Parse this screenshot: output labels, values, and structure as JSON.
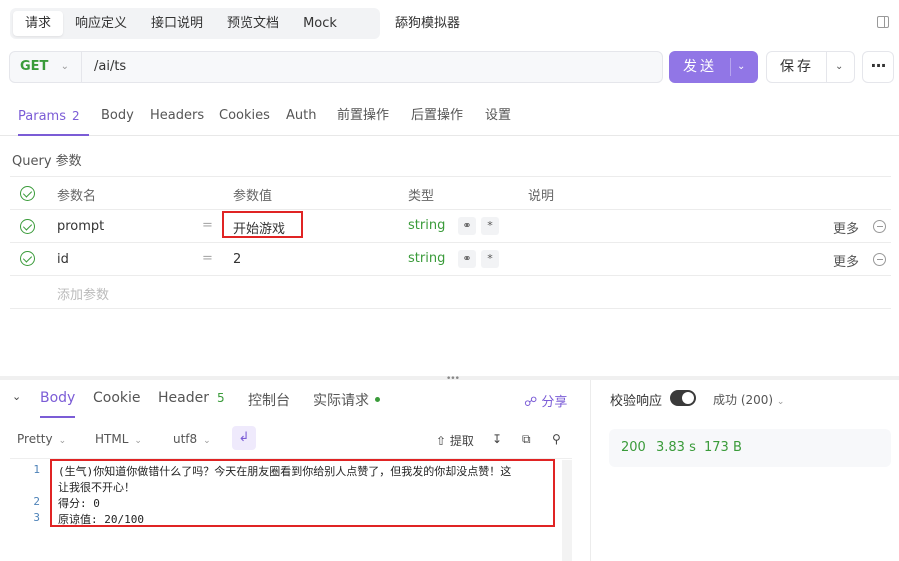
{
  "top_tabs": [
    "请求",
    "响应定义",
    "接口说明",
    "预览文档",
    "Mock"
  ],
  "top_tab_extra": "舔狗模拟器",
  "request": {
    "method": "GET",
    "url": "/ai/ts"
  },
  "buttons": {
    "send": "发送",
    "save": "保存",
    "more": "···"
  },
  "sub_tabs": [
    {
      "label": "Params",
      "count": "2"
    },
    {
      "label": "Body"
    },
    {
      "label": "Headers"
    },
    {
      "label": "Cookies"
    },
    {
      "label": "Auth"
    },
    {
      "label": "前置操作"
    },
    {
      "label": "后置操作"
    },
    {
      "label": "设置"
    }
  ],
  "query": {
    "title": "Query 参数",
    "headers": {
      "name": "参数名",
      "value": "参数值",
      "type": "类型",
      "desc": "说明"
    },
    "rows": [
      {
        "name": "prompt",
        "value": "开始游戏",
        "type": "string",
        "more": "更多"
      },
      {
        "name": "id",
        "value": "2",
        "type": "string",
        "more": "更多"
      }
    ],
    "add_placeholder": "添加参数"
  },
  "response_tabs": [
    {
      "label": "Body"
    },
    {
      "label": "Cookie"
    },
    {
      "label": "Header",
      "count": "5"
    },
    {
      "label": "控制台"
    },
    {
      "label": "实际请求"
    }
  ],
  "share_label": "分享",
  "format": {
    "pretty": "Pretty",
    "lang": "HTML",
    "encoding": "utf8",
    "extract": "提取"
  },
  "code_lines": [
    {
      "num": "1",
      "text": "(生气)你知道你做错什么了吗？今天在朋友圈看到你给别人点赞了，但我发的你却没点赞！这"
    },
    {
      "num": "",
      "text": "让我很不开心！"
    },
    {
      "num": "2",
      "text": "得分: 0"
    },
    {
      "num": "3",
      "text": "原谅值: 20/100"
    }
  ],
  "validate": {
    "label": "校验响应",
    "status": "成功 (200)"
  },
  "metrics": {
    "code": "200",
    "time": "3.83 s",
    "size": "173 B"
  },
  "colors": {
    "accent": "#7b5cd6",
    "send": "#9176e6",
    "success": "#3a9b3a",
    "highlight": "#e02424"
  }
}
